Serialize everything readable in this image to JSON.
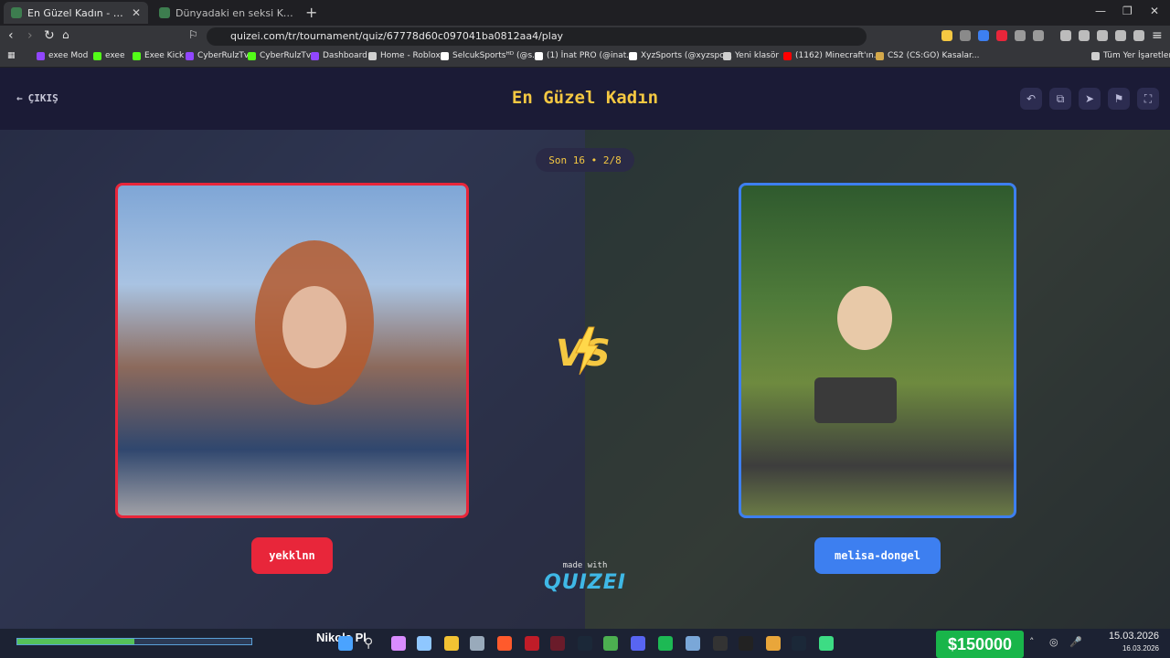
{
  "browser": {
    "tabs": [
      {
        "title": "En Güzel Kadın - Tier List, Kör Se",
        "active": true
      },
      {
        "title": "Dünyadaki en seksi Kadın kim - Tier L",
        "active": false
      }
    ],
    "url": "quizei.com/tr/tournament/quiz/67778d60c097041ba0812aa4/play",
    "bookmarks": [
      {
        "label": "exee Mod",
        "icon_color": "#9146ff"
      },
      {
        "label": "exee",
        "icon_color": "#53fc18"
      },
      {
        "label": "Exee Kick",
        "icon_color": "#53fc18"
      },
      {
        "label": "CyberRulzTv",
        "icon_color": "#9146ff"
      },
      {
        "label": "CyberRulzTv",
        "icon_color": "#53fc18"
      },
      {
        "label": "Dashboard",
        "icon_color": "#9146ff"
      },
      {
        "label": "Home - Roblox",
        "icon_color": "#d0d0d0"
      },
      {
        "label": "SelcukSportsᴴᴰ (@s...",
        "icon_color": "#ffffff"
      },
      {
        "label": "(1) İnat PRO (@inat...",
        "icon_color": "#ffffff"
      },
      {
        "label": "XyzSports (@xyzspo...",
        "icon_color": "#ffffff"
      },
      {
        "label": "Yeni klasör",
        "icon_color": "#cfcfcf"
      },
      {
        "label": "(1162) Minecraft'ın...",
        "icon_color": "#ff0000"
      },
      {
        "label": "CS2 (CS:GO) Kasalar...",
        "icon_color": "#d4a84a"
      }
    ],
    "all_bookmarks_label": "Tüm Yer İşaretleri"
  },
  "header": {
    "exit_label": "ÇIKIŞ",
    "title": "En Güzel Kadın"
  },
  "round_badge": "Son 16 • 2/8",
  "contenders": {
    "left": {
      "name": "yekklnn",
      "color": "#e8263a"
    },
    "right": {
      "name": "melisa-dongel",
      "color": "#3d7ff0"
    }
  },
  "vs_label": "VS",
  "footer": {
    "made_with": "made with",
    "brand": "QUIZEI"
  },
  "taskbar": {
    "game_text": "Nikola Pl",
    "money": "$150000",
    "time": "15.03.2026",
    "date": "16.03.2026"
  }
}
